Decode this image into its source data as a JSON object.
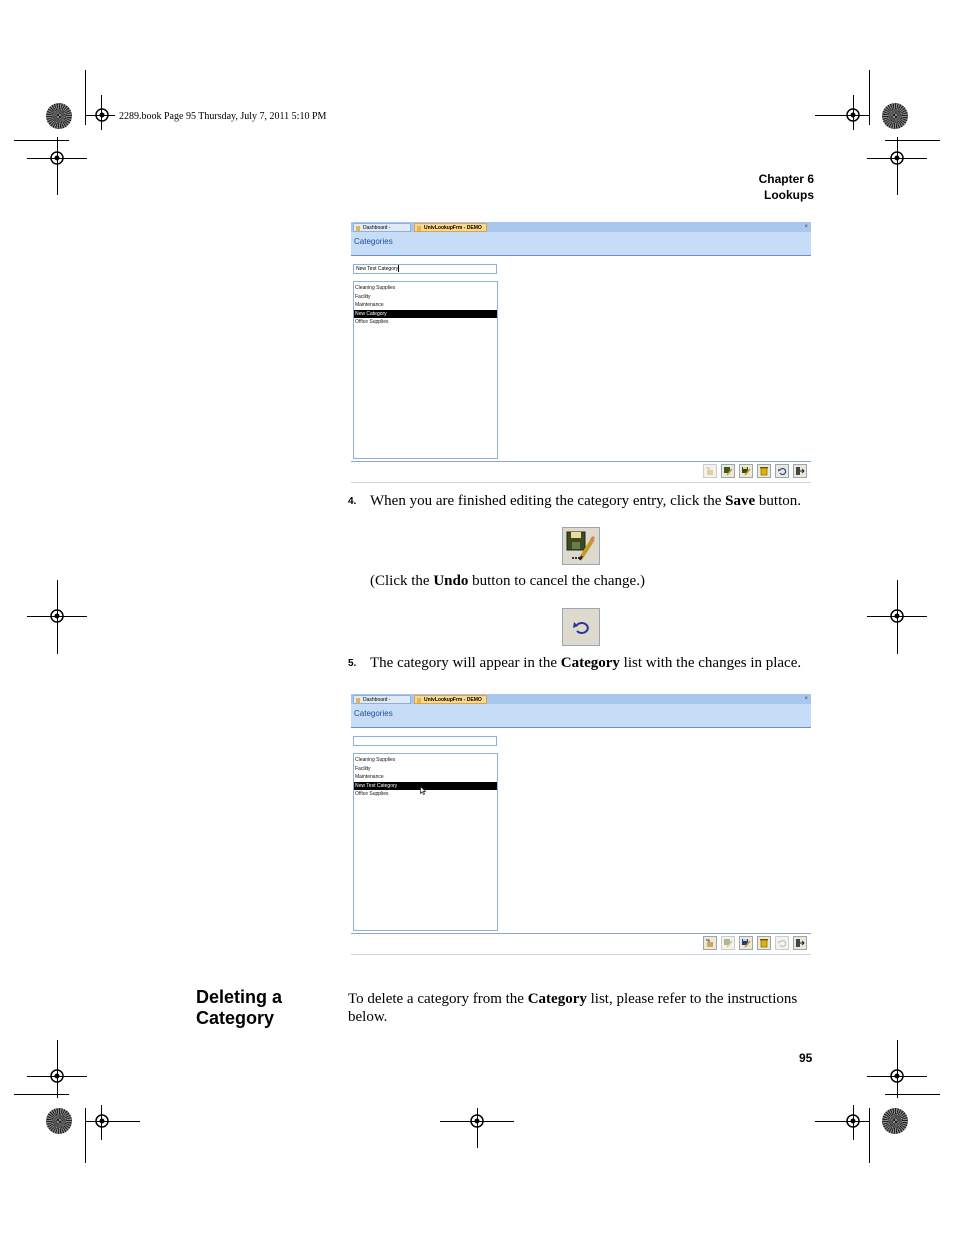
{
  "print_header": {
    "text": "2289.book  Page 95  Thursday, July 7, 2011  5:10 PM"
  },
  "chapter": {
    "number_label": "Chapter 6",
    "title": "Lookups"
  },
  "screenshot_1": {
    "tabs": [
      {
        "label": "Dashboard - DEMO",
        "active": false
      },
      {
        "label": "UnivLookupFrm - DEMO",
        "active": true
      }
    ],
    "close_glyph": "×",
    "title": "Categories",
    "textbox_value": "New Test Category",
    "list_items": [
      "Cleaning Supplies",
      "Facility",
      "Maintenance",
      "New Category",
      "Office Supplies"
    ],
    "selected_index": 3
  },
  "step4": {
    "number": "4.",
    "text_before": "When you are finished editing the category entry, click the ",
    "bold": "Save",
    "text_after": " button.",
    "save_icon": "save-icon",
    "note_before": "(Click the ",
    "note_bold": "Undo",
    "note_after": " button to cancel the change.)",
    "undo_icon": "undo-icon"
  },
  "step5": {
    "number": "5.",
    "text_before": "The category will appear in the ",
    "bold": "Category",
    "text_after": " list with the changes in place."
  },
  "screenshot_2": {
    "tabs": [
      {
        "label": "Dashboard - DEMO",
        "active": false
      },
      {
        "label": "UnivLookupFrm - DEMO",
        "active": true
      }
    ],
    "close_glyph": "×",
    "title": "Categories",
    "textbox_value": "",
    "list_items": [
      "Cleaning Supplies",
      "Facility",
      "Maintenance",
      "New Test Category",
      "Office Supplies"
    ],
    "selected_index": 3
  },
  "section": {
    "heading_line1": "Deleting a",
    "heading_line2": "Category",
    "text_before": "To delete a category from the ",
    "bold": "Category",
    "text_line1_after": " list, please refer to the instructions",
    "text_line2": "below."
  },
  "page_number": "95",
  "colors": {
    "tab_bar": "#a9c7ec",
    "title_bar": "#c6dcf7",
    "active_tab": "#fbd88f",
    "title_text": "#1f4f9a",
    "selection": "#000000"
  }
}
